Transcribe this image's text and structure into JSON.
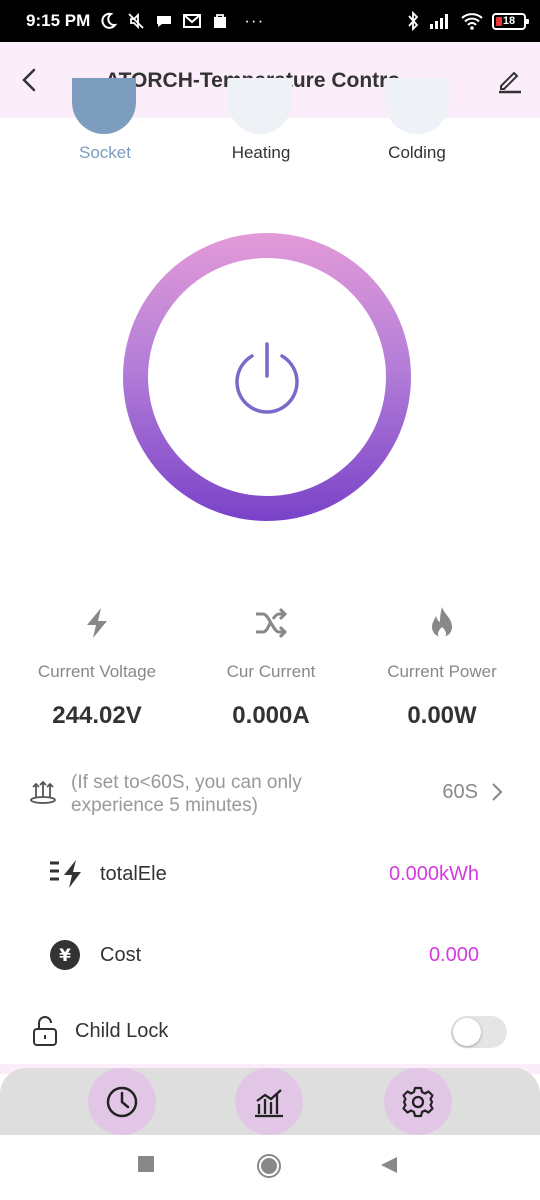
{
  "status_bar": {
    "time": "9:15 PM",
    "dots": "···",
    "battery": "18"
  },
  "header": {
    "title": "ATORCH-Temperature Contro…"
  },
  "modes": [
    {
      "label": "Socket",
      "color": "#7a9cbf",
      "selected": true
    },
    {
      "label": "Heating",
      "color": "#333333",
      "selected": false
    },
    {
      "label": "Colding",
      "color": "#333333",
      "selected": false
    }
  ],
  "power": {
    "ring_gradient": [
      "#e39ad8",
      "#7a42c8"
    ],
    "icon_color": "#7b68c9"
  },
  "metrics": [
    {
      "label": "Current Voltage",
      "value": "244.02V",
      "icon": "lightning-icon"
    },
    {
      "label": "Cur Current",
      "value": "0.000A",
      "icon": "shuffle-icon"
    },
    {
      "label": "Current Power",
      "value": "0.00W",
      "icon": "flame-icon"
    }
  ],
  "timer": {
    "text": "(If set to<60S, you can only experience 5 minutes)",
    "value": "60S"
  },
  "total_ele": {
    "label": "totalEle",
    "value": "0.000kWh"
  },
  "cost": {
    "label": "Cost",
    "value": "0.000",
    "symbol": "¥"
  },
  "child_lock": {
    "label": "Child Lock",
    "enabled": false
  },
  "colors": {
    "accent": "#d63ae0",
    "header_bg": "#fbeefa",
    "nav_btn_bg": "#e2c6e6"
  }
}
